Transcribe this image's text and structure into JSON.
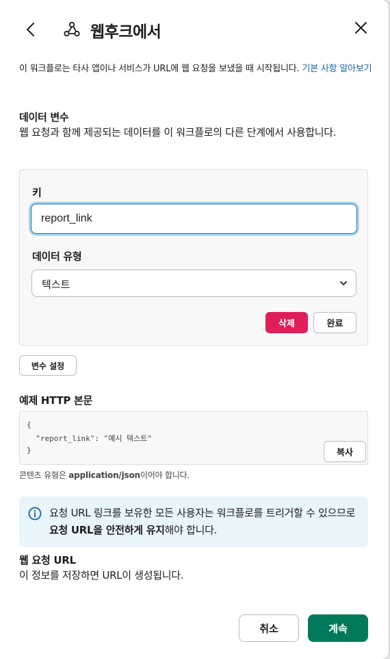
{
  "header": {
    "title": "웹후크에서"
  },
  "intro": {
    "text": "이 워크플로는 타사 앱이나 서비스가 URL에 웹 요청을 보냈을 때 시작됩니다.",
    "link": "기본 사항 알아보기"
  },
  "data_variables": {
    "title": "데이터 변수",
    "description": "웹 요청과 함께 제공되는 데이터를 이 워크플로의 다른 단계에서 사용합니다.",
    "key_label": "키",
    "key_value": "report_link",
    "type_label": "데이터 유형",
    "type_value": "텍스트",
    "delete_label": "삭제",
    "done_label": "완료",
    "setup_label": "변수 설정"
  },
  "example_body": {
    "title": "예제 HTTP 본문",
    "lines": [
      "{",
      "  \"report_link\": \"예시 텍스트\"",
      "}"
    ],
    "copy_label": "복사",
    "content_type_prefix": "콘텐츠 유형은 ",
    "content_type_value": "application/json",
    "content_type_suffix": "이어야 합니다."
  },
  "info": {
    "text_before": "요청 URL 링크를 보유한 모든 사용자는 워크플로를 트리거할 수 있으므로 ",
    "text_bold": "요청 URL을 안전하게 유지",
    "text_after": "해야 합니다."
  },
  "web_request_url": {
    "title": "웹 요청 URL",
    "description": "이 정보를 저장하면 URL이 생성됩니다."
  },
  "footer": {
    "cancel_label": "취소",
    "continue_label": "계속"
  },
  "colors": {
    "delete": "#e01e5a",
    "continue": "#007a5a",
    "link": "#1264a3",
    "info_bg": "#e8f5fa"
  },
  "icons": [
    "back-arrow-icon",
    "webhook-icon",
    "close-icon",
    "chevron-down-icon",
    "info-icon"
  ]
}
